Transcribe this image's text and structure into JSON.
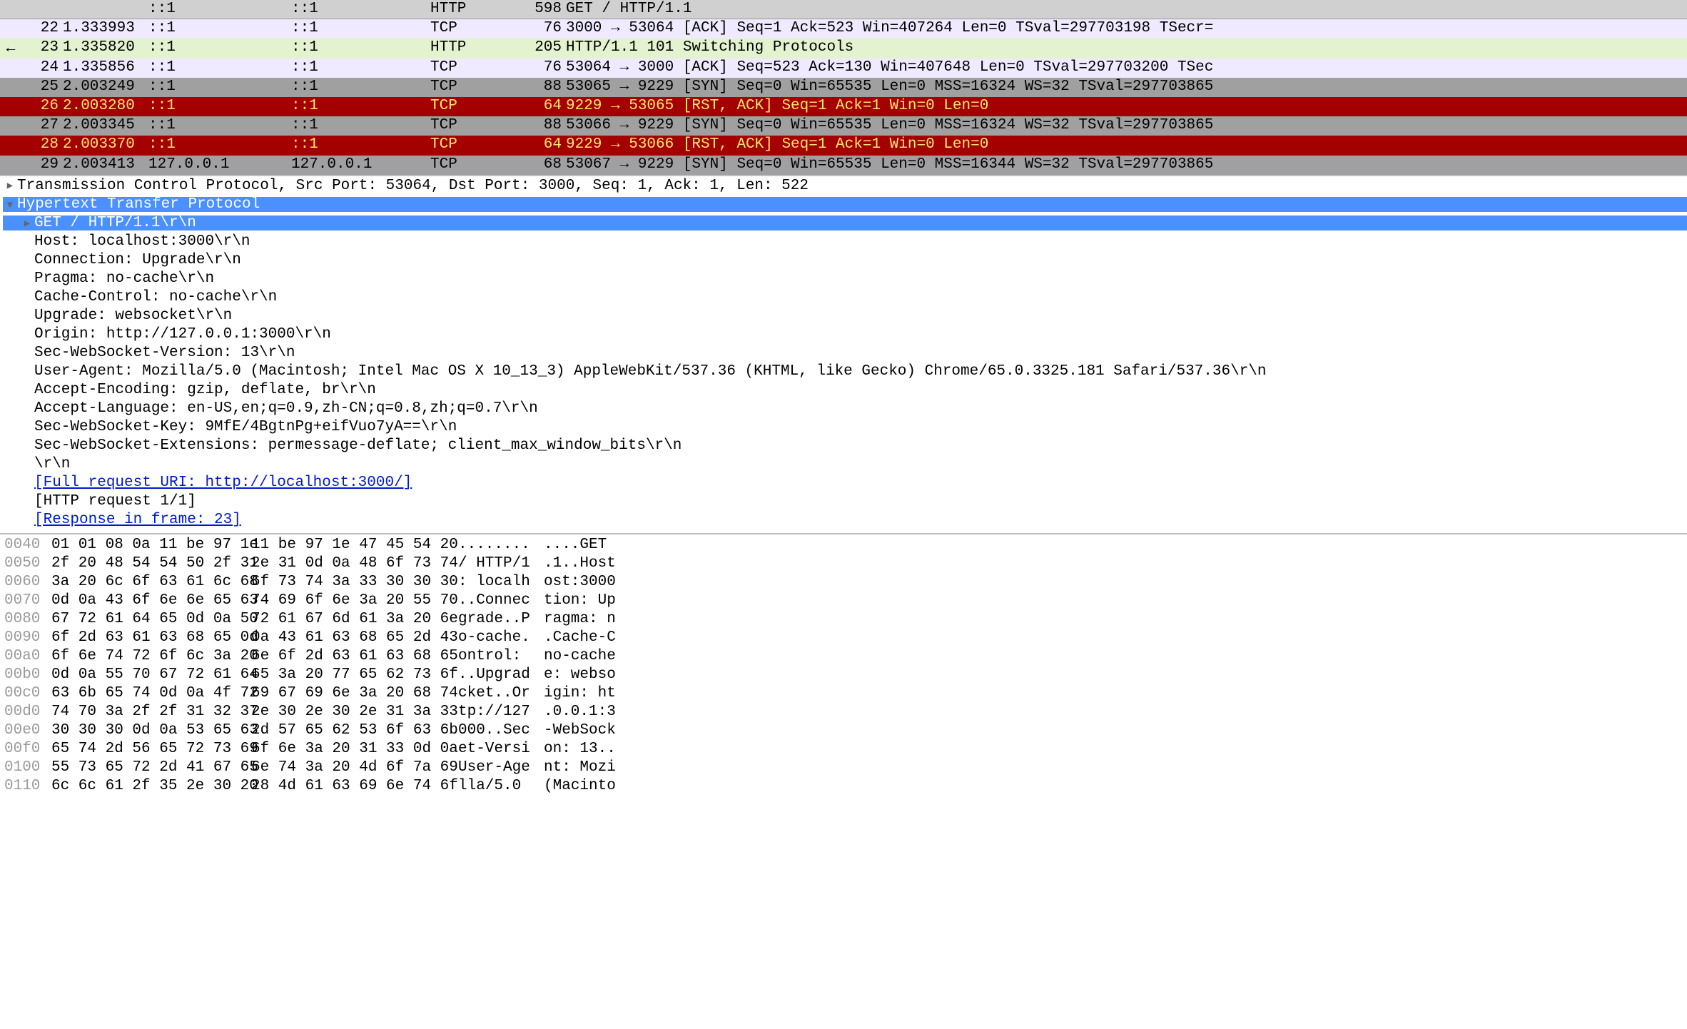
{
  "packets": [
    {
      "gutter": "",
      "num": "",
      "time": "",
      "src": "::1",
      "dst": "::1",
      "proto": "HTTP",
      "len": "598",
      "info": "GET / HTTP/1.1",
      "cls": "c-header"
    },
    {
      "gutter": "",
      "num": "22",
      "time": "1.333993",
      "src": "::1",
      "dst": "::1",
      "proto": "TCP",
      "len": "76",
      "info": "3000 → 53064 [ACK] Seq=1 Ack=523 Win=407264 Len=0 TSval=297703198 TSecr=",
      "cls": "c-default"
    },
    {
      "gutter": "←",
      "num": "23",
      "time": "1.335820",
      "src": "::1",
      "dst": "::1",
      "proto": "HTTP",
      "len": "205",
      "info": "HTTP/1.1 101 Switching Protocols",
      "cls": "c-http-green"
    },
    {
      "gutter": "",
      "num": "24",
      "time": "1.335856",
      "src": "::1",
      "dst": "::1",
      "proto": "TCP",
      "len": "76",
      "info": "53064 → 3000 [ACK] Seq=523 Ack=130 Win=407648 Len=0 TSval=297703200 TSec",
      "cls": "c-default"
    },
    {
      "gutter": "",
      "num": "25",
      "time": "2.003249",
      "src": "::1",
      "dst": "::1",
      "proto": "TCP",
      "len": "88",
      "info": "53065 → 9229 [SYN] Seq=0 Win=65535 Len=0 MSS=16324 WS=32 TSval=297703865",
      "cls": "c-gray"
    },
    {
      "gutter": "",
      "num": "26",
      "time": "2.003280",
      "src": "::1",
      "dst": "::1",
      "proto": "TCP",
      "len": "64",
      "info": "9229 → 53065 [RST, ACK] Seq=1 Ack=1 Win=0 Len=0",
      "cls": "c-red"
    },
    {
      "gutter": "",
      "num": "27",
      "time": "2.003345",
      "src": "::1",
      "dst": "::1",
      "proto": "TCP",
      "len": "88",
      "info": "53066 → 9229 [SYN] Seq=0 Win=65535 Len=0 MSS=16324 WS=32 TSval=297703865",
      "cls": "c-gray"
    },
    {
      "gutter": "",
      "num": "28",
      "time": "2.003370",
      "src": "::1",
      "dst": "::1",
      "proto": "TCP",
      "len": "64",
      "info": "9229 → 53066 [RST, ACK] Seq=1 Ack=1 Win=0 Len=0",
      "cls": "c-red"
    },
    {
      "gutter": "",
      "num": "29",
      "time": "2.003413",
      "src": "127.0.0.1",
      "dst": "127.0.0.1",
      "proto": "TCP",
      "len": "68",
      "info": "53067 → 9229 [SYN] Seq=0 Win=65535 Len=0 MSS=16344 WS=32 TSval=297703865",
      "cls": "c-gray"
    }
  ],
  "details": [
    {
      "indent": 0,
      "tri": "closed",
      "text": "Transmission Control Protocol, Src Port: 53064, Dst Port: 3000, Seq: 1, Ack: 1, Len: 522",
      "hl": false
    },
    {
      "indent": 0,
      "tri": "open",
      "text": "Hypertext Transfer Protocol",
      "hl": true
    },
    {
      "indent": 1,
      "tri": "closed",
      "text": "GET / HTTP/1.1\\r\\n",
      "hl": true
    },
    {
      "indent": 1,
      "tri": "none",
      "text": "Host: localhost:3000\\r\\n"
    },
    {
      "indent": 1,
      "tri": "none",
      "text": "Connection: Upgrade\\r\\n"
    },
    {
      "indent": 1,
      "tri": "none",
      "text": "Pragma: no-cache\\r\\n"
    },
    {
      "indent": 1,
      "tri": "none",
      "text": "Cache-Control: no-cache\\r\\n"
    },
    {
      "indent": 1,
      "tri": "none",
      "text": "Upgrade: websocket\\r\\n"
    },
    {
      "indent": 1,
      "tri": "none",
      "text": "Origin: http://127.0.0.1:3000\\r\\n"
    },
    {
      "indent": 1,
      "tri": "none",
      "text": "Sec-WebSocket-Version: 13\\r\\n"
    },
    {
      "indent": 1,
      "tri": "none",
      "text": "User-Agent: Mozilla/5.0 (Macintosh; Intel Mac OS X 10_13_3) AppleWebKit/537.36 (KHTML, like Gecko) Chrome/65.0.3325.181 Safari/537.36\\r\\n"
    },
    {
      "indent": 1,
      "tri": "none",
      "text": "Accept-Encoding: gzip, deflate, br\\r\\n"
    },
    {
      "indent": 1,
      "tri": "none",
      "text": "Accept-Language: en-US,en;q=0.9,zh-CN;q=0.8,zh;q=0.7\\r\\n"
    },
    {
      "indent": 1,
      "tri": "none",
      "text": "Sec-WebSocket-Key: 9MfE/4BgtnPg+eifVuo7yA==\\r\\n"
    },
    {
      "indent": 1,
      "tri": "none",
      "text": "Sec-WebSocket-Extensions: permessage-deflate; client_max_window_bits\\r\\n"
    },
    {
      "indent": 1,
      "tri": "none",
      "text": "\\r\\n"
    },
    {
      "indent": 1,
      "tri": "none",
      "text": "[Full request URI: http://localhost:3000/]",
      "link": true
    },
    {
      "indent": 1,
      "tri": "none",
      "text": "[HTTP request 1/1]"
    },
    {
      "indent": 1,
      "tri": "none",
      "text": "[Response in frame: 23]",
      "link": true
    }
  ],
  "hex": [
    {
      "off": "0040",
      "b1": "01 01 08 0a 11 be 97 1e",
      "b2": "11 be 97 1e 47 45 54 20",
      "a1": "........",
      "a2": "....GET "
    },
    {
      "off": "0050",
      "b1": "2f 20 48 54 54 50 2f 31",
      "b2": "2e 31 0d 0a 48 6f 73 74",
      "a1": "/ HTTP/1",
      "a2": ".1..Host"
    },
    {
      "off": "0060",
      "b1": "3a 20 6c 6f 63 61 6c 68",
      "b2": "6f 73 74 3a 33 30 30 30",
      "a1": ": localh",
      "a2": "ost:3000"
    },
    {
      "off": "0070",
      "b1": "0d 0a 43 6f 6e 6e 65 63",
      "b2": "74 69 6f 6e 3a 20 55 70",
      "a1": "..Connec",
      "a2": "tion: Up"
    },
    {
      "off": "0080",
      "b1": "67 72 61 64 65 0d 0a 50",
      "b2": "72 61 67 6d 61 3a 20 6e",
      "a1": "grade..P",
      "a2": "ragma: n"
    },
    {
      "off": "0090",
      "b1": "6f 2d 63 61 63 68 65 0d",
      "b2": "0a 43 61 63 68 65 2d 43",
      "a1": "o-cache.",
      "a2": ".Cache-C"
    },
    {
      "off": "00a0",
      "b1": "6f 6e 74 72 6f 6c 3a 20",
      "b2": "6e 6f 2d 63 61 63 68 65",
      "a1": "ontrol: ",
      "a2": "no-cache"
    },
    {
      "off": "00b0",
      "b1": "0d 0a 55 70 67 72 61 64",
      "b2": "65 3a 20 77 65 62 73 6f",
      "a1": "..Upgrad",
      "a2": "e: webso"
    },
    {
      "off": "00c0",
      "b1": "63 6b 65 74 0d 0a 4f 72",
      "b2": "69 67 69 6e 3a 20 68 74",
      "a1": "cket..Or",
      "a2": "igin: ht"
    },
    {
      "off": "00d0",
      "b1": "74 70 3a 2f 2f 31 32 37",
      "b2": "2e 30 2e 30 2e 31 3a 33",
      "a1": "tp://127",
      "a2": ".0.0.1:3"
    },
    {
      "off": "00e0",
      "b1": "30 30 30 0d 0a 53 65 63",
      "b2": "2d 57 65 62 53 6f 63 6b",
      "a1": "000..Sec",
      "a2": "-WebSock"
    },
    {
      "off": "00f0",
      "b1": "65 74 2d 56 65 72 73 69",
      "b2": "6f 6e 3a 20 31 33 0d 0a",
      "a1": "et-Versi",
      "a2": "on: 13.."
    },
    {
      "off": "0100",
      "b1": "55 73 65 72 2d 41 67 65",
      "b2": "6e 74 3a 20 4d 6f 7a 69",
      "a1": "User-Age",
      "a2": "nt: Mozi"
    },
    {
      "off": "0110",
      "b1": "6c 6c 61 2f 35 2e 30 20",
      "b2": "28 4d 61 63 69 6e 74 6f",
      "a1": "lla/5.0 ",
      "a2": "(Macinto"
    }
  ]
}
